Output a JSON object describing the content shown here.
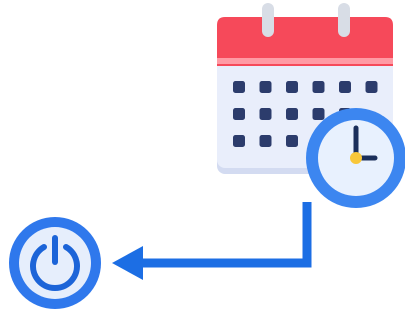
{
  "illustration": {
    "elements": [
      {
        "name": "calendar-icon"
      },
      {
        "name": "clock-icon"
      },
      {
        "name": "arrow-connector"
      },
      {
        "name": "power-button-icon"
      }
    ]
  },
  "calendar": {
    "grid": {
      "rows": 3,
      "columns": 6,
      "omitted_cells": [
        [
          1,
          5
        ],
        [
          2,
          4
        ],
        [
          2,
          5
        ]
      ]
    }
  },
  "colors": {
    "calendar_header": "#f6495a",
    "calendar_header_stripe": "#ff9aa4",
    "calendar_body": "#e9eefb",
    "calendar_body_shadow": "#d3dbf1",
    "calendar_dot": "#2c3c6c",
    "calendar_ring": "#d8dde6",
    "clock_outer": "#3c86f0",
    "clock_face": "#e8f1fe",
    "clock_hand": "#1b2f5b",
    "clock_center": "#f8c73a",
    "arrow": "#1c6ee4",
    "power_outer": "#2f78ec",
    "power_inner": "#e6eefc",
    "power_symbol": "#1c64d8"
  }
}
